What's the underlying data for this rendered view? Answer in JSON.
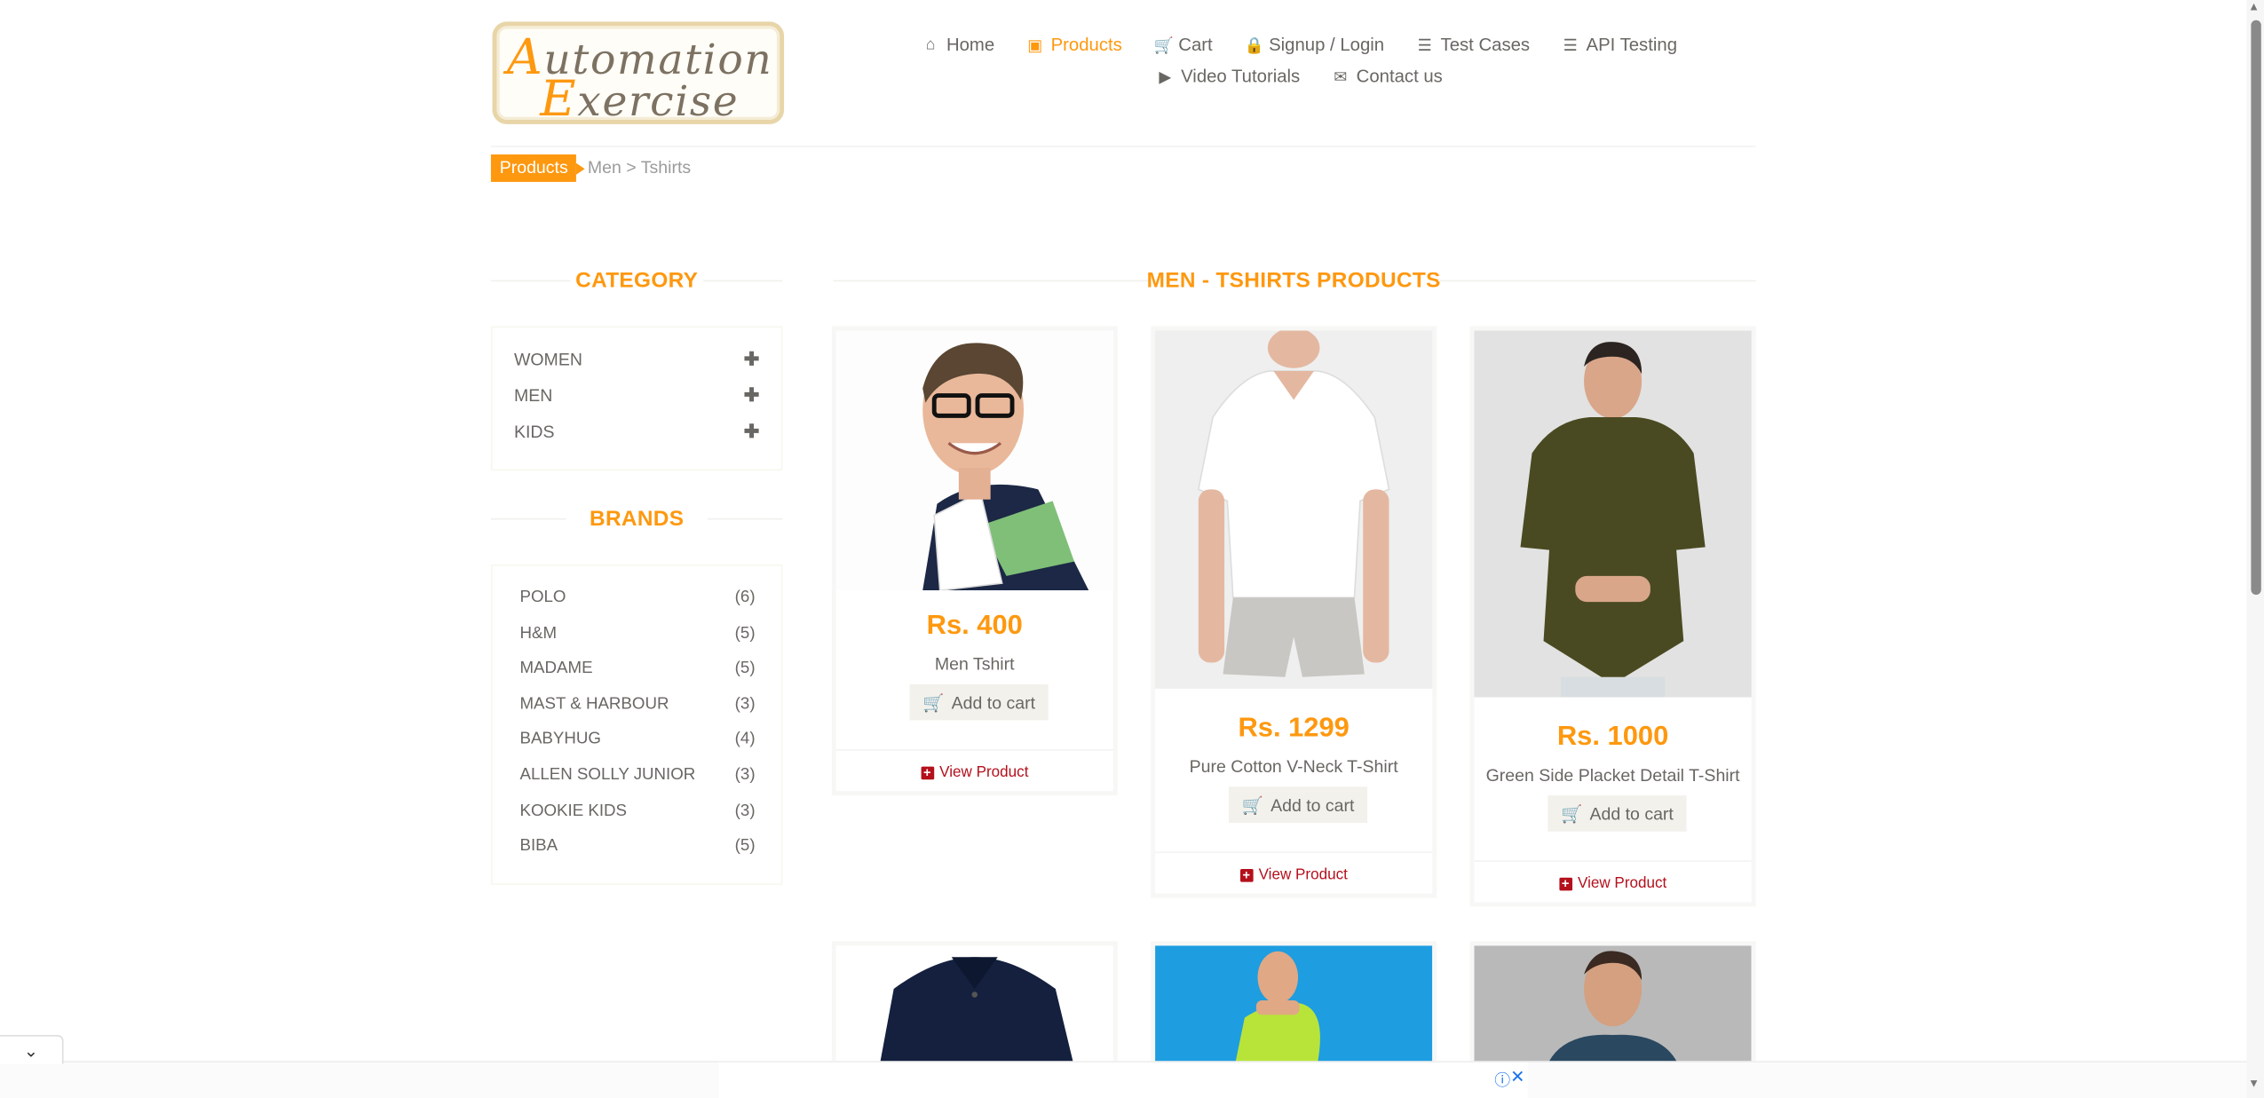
{
  "logo": {
    "line1_cap": "A",
    "line1_rest": "utomation",
    "line2_cap": "E",
    "line2_rest": "xercise"
  },
  "nav": {
    "items": [
      {
        "label": "Home",
        "icon": "home-icon",
        "glyph": "⌂"
      },
      {
        "label": "Products",
        "icon": "shopping-bag-icon",
        "glyph": "▣",
        "active": true
      },
      {
        "label": "Cart",
        "icon": "cart-icon",
        "glyph": "🛒"
      },
      {
        "label": "Signup / Login",
        "icon": "lock-icon",
        "glyph": "🔒"
      },
      {
        "label": "Test Cases",
        "icon": "list-icon",
        "glyph": "☰"
      },
      {
        "label": "API Testing",
        "icon": "list-icon",
        "glyph": "☰"
      },
      {
        "label": "Video Tutorials",
        "icon": "youtube-icon",
        "glyph": "▶"
      },
      {
        "label": "Contact us",
        "icon": "envelope-icon",
        "glyph": "✉"
      }
    ]
  },
  "breadcrumb": {
    "active": "Products",
    "rest": "Men > Tshirts"
  },
  "sidebar": {
    "category_title": "CATEGORY",
    "categories": [
      {
        "label": "WOMEN"
      },
      {
        "label": "MEN"
      },
      {
        "label": "KIDS"
      }
    ],
    "brands_title": "BRANDS",
    "brands": [
      {
        "name": "POLO",
        "count": "(6)"
      },
      {
        "name": "H&M",
        "count": "(5)"
      },
      {
        "name": "MADAME",
        "count": "(5)"
      },
      {
        "name": "MAST & HARBOUR",
        "count": "(3)"
      },
      {
        "name": "BABYHUG",
        "count": "(4)"
      },
      {
        "name": "ALLEN SOLLY JUNIOR",
        "count": "(3)"
      },
      {
        "name": "KOOKIE KIDS",
        "count": "(3)"
      },
      {
        "name": "BIBA",
        "count": "(5)"
      }
    ]
  },
  "main": {
    "title": "MEN - TSHIRTS PRODUCTS",
    "add_to_cart": "Add to cart",
    "view_product": "View Product",
    "products": [
      {
        "price": "Rs. 400",
        "name": "Men Tshirt"
      },
      {
        "price": "Rs. 1299",
        "name": "Pure Cotton V-Neck T-Shirt"
      },
      {
        "price": "Rs. 1000",
        "name": "Green Side Placket Detail T-Shirt"
      }
    ]
  },
  "colors": {
    "accent": "#fe980f",
    "text": "#696763",
    "link_red": "#b4101c"
  }
}
